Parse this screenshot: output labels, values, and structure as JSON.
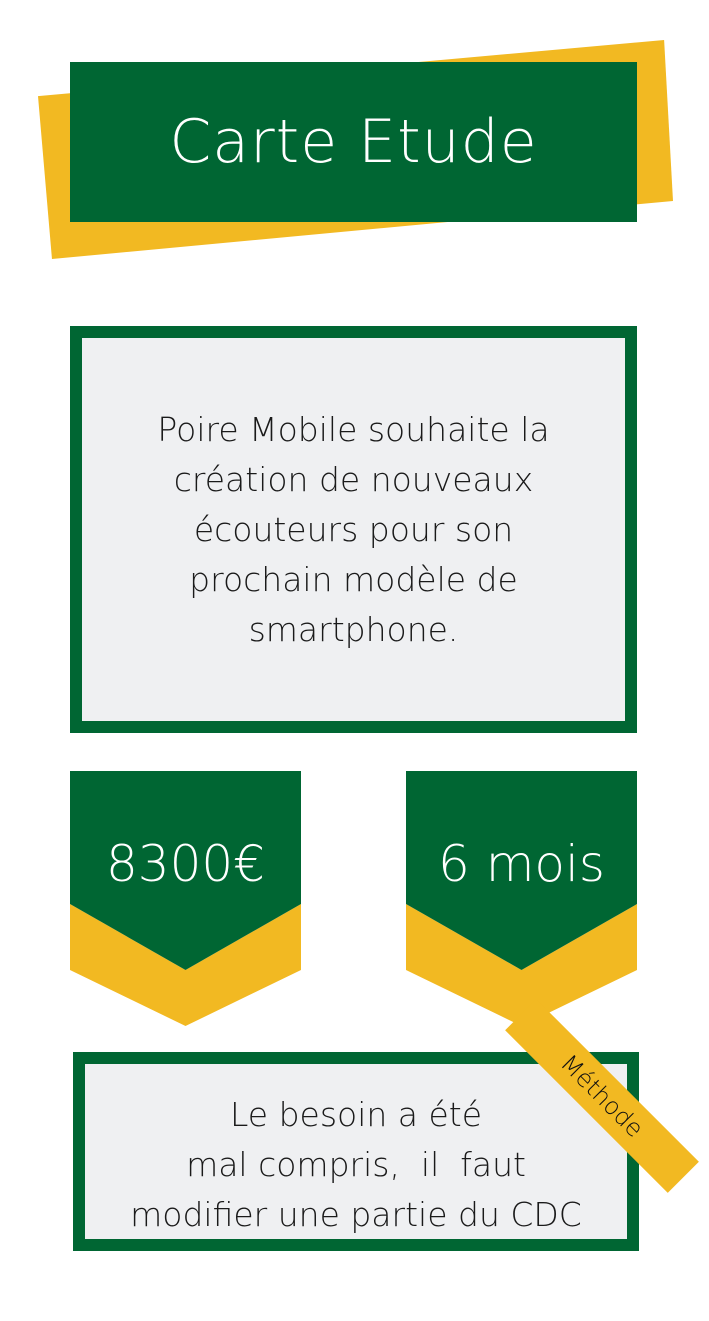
{
  "colors": {
    "green": "#006633",
    "yellow": "#f2b922",
    "box": "#eff0f2"
  },
  "title": "Carte Etude",
  "description": "Poire Mobile souhaite la création de nouveaux écouteurs pour son prochain modèle de smartphone.",
  "stats": [
    {
      "value": "8300€"
    },
    {
      "value": "6 mois"
    }
  ],
  "remark": {
    "lines": [
      "Le besoin a été",
      "mal compris,  il  faut",
      "modifier une partie du CDC"
    ]
  },
  "ribbon": {
    "label": "Méthode"
  }
}
